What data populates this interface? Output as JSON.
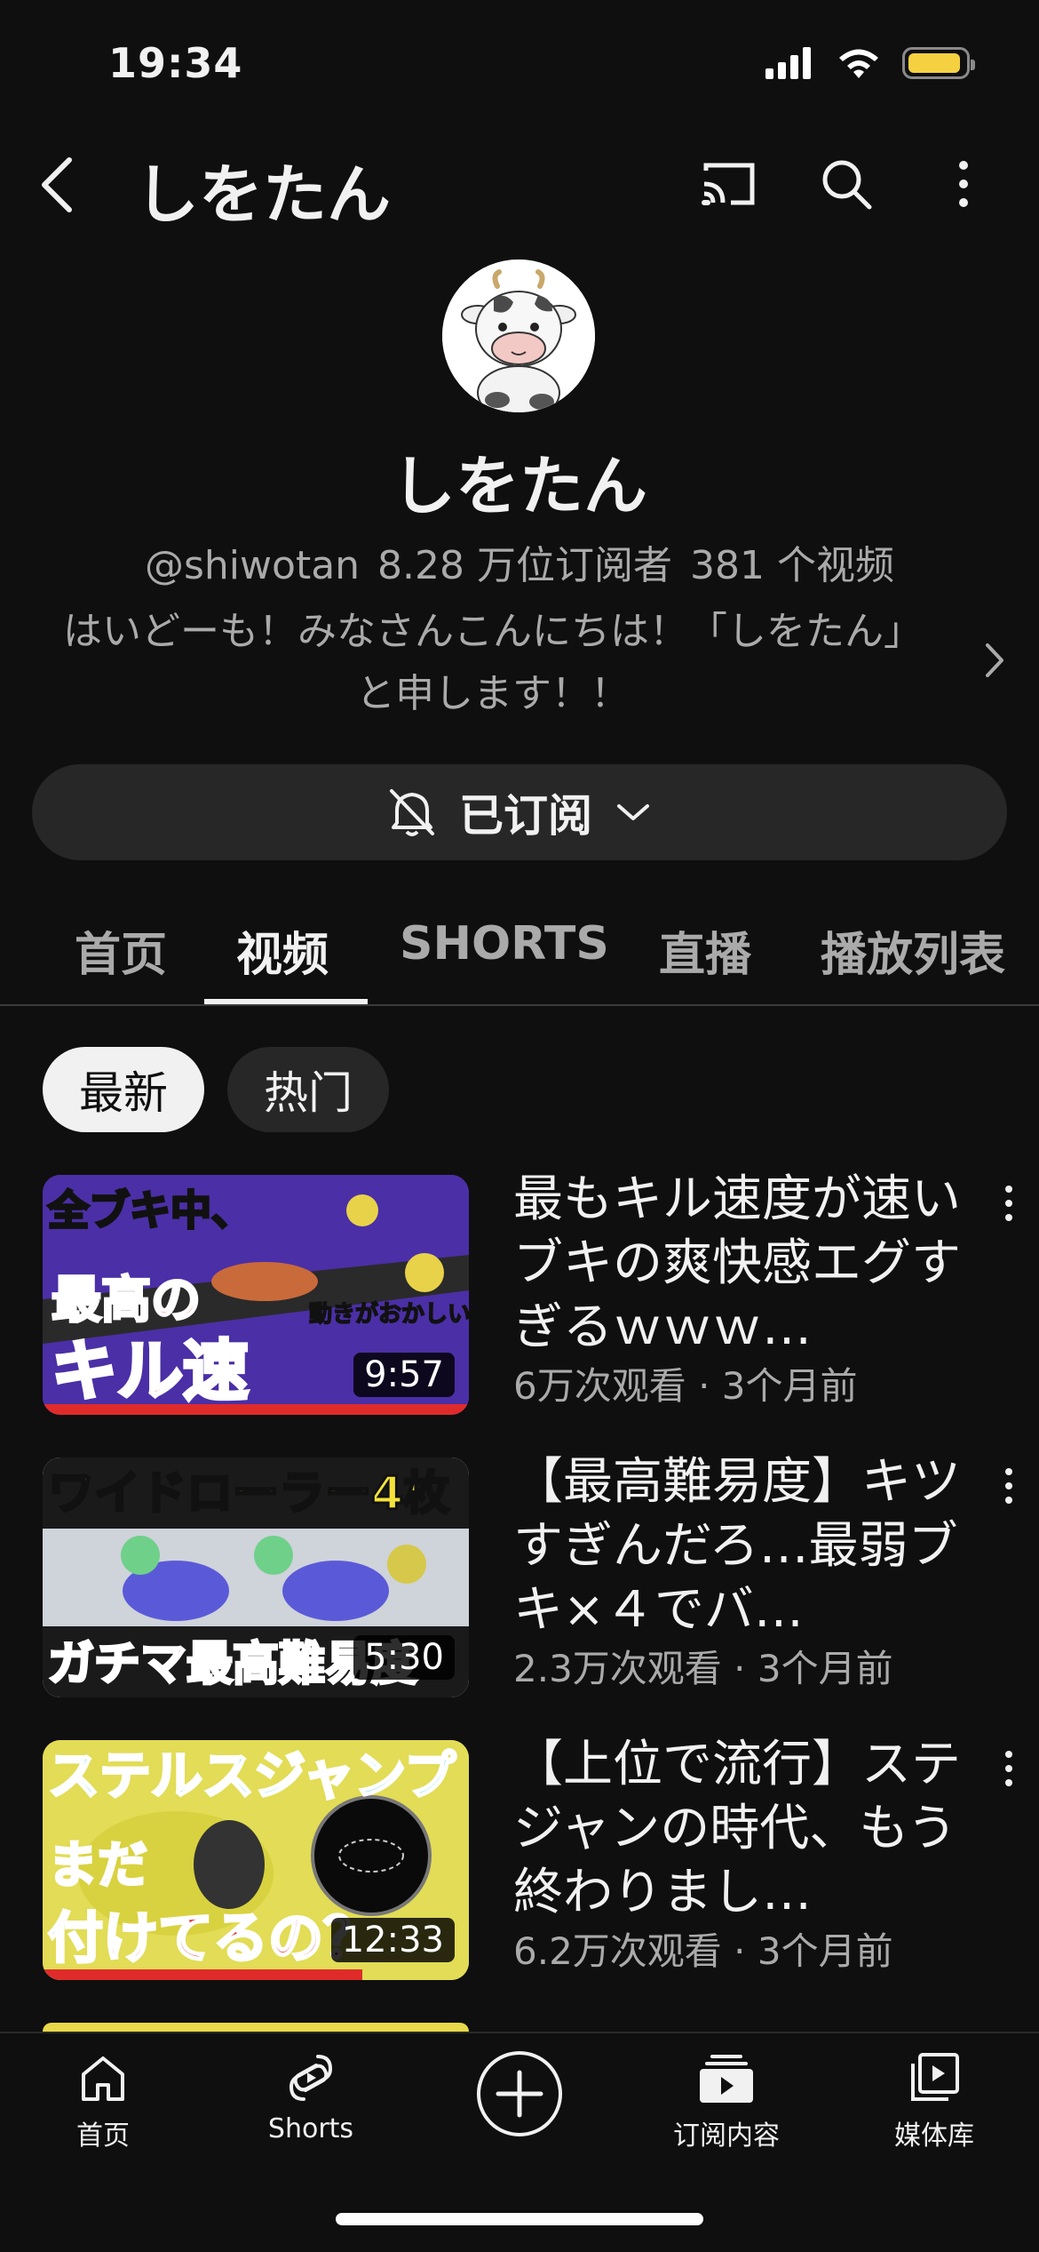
{
  "status_bar": {
    "time": "19:34"
  },
  "header": {
    "title": "しをたん"
  },
  "channel": {
    "name": "しをたん",
    "handle": "@shiwotan",
    "subscribers": "8.28 万位订阅者",
    "video_count": "381 个视频",
    "description": "はいどーも！みなさんこんにちは！「しをたん」と申します！！"
  },
  "subscribe": {
    "label": "已订阅"
  },
  "tabs": [
    {
      "label": "首页"
    },
    {
      "label": "视频"
    },
    {
      "label": "SHORTS"
    },
    {
      "label": "直播"
    },
    {
      "label": "播放列表"
    }
  ],
  "chips": [
    {
      "label": "最新"
    },
    {
      "label": "热门"
    }
  ],
  "videos": [
    {
      "title": "最もキル速度が速いブキの爽快感エグすぎるｗｗｗ…",
      "meta": "6万次观看 · 3个月前",
      "duration": "9:57",
      "thumb_text": [
        "全ブキ中、",
        "最高の",
        "キル速",
        "動きがおかしい"
      ],
      "thumb_colors": {
        "bg": "#5b3fb8",
        "text": "#ff3b3b",
        "accent": "#6fe04a"
      }
    },
    {
      "title": "【最高難易度】キツすぎんだろ…最弱ブキ×４でバ…",
      "meta": "2.3万次观看 · 3个月前",
      "duration": "5:30",
      "thumb_text": [
        "ワイドローラー4枚",
        "ガチマ最高難易度"
      ],
      "thumb_colors": {
        "bg": "#d8d8d8",
        "text": "#f5e23a",
        "accent": "#e03030"
      }
    },
    {
      "title": "【上位で流行】ステジャンの時代、もう終わりまし…",
      "meta": "6.2万次观看 · 3个月前",
      "duration": "12:33",
      "thumb_text": [
        "ステルスジャンプ",
        "まだ",
        "付けてるの？"
      ],
      "thumb_colors": {
        "bg": "#e7e04a",
        "text": "#2fd0e8",
        "accent": "#e02b2b"
      }
    }
  ],
  "bottom_nav": [
    {
      "label": "首页",
      "icon": "home-icon"
    },
    {
      "label": "Shorts",
      "icon": "shorts-icon"
    },
    {
      "label": "",
      "icon": "create-icon"
    },
    {
      "label": "订阅内容",
      "icon": "subscriptions-icon"
    },
    {
      "label": "媒体库",
      "icon": "library-icon"
    }
  ]
}
